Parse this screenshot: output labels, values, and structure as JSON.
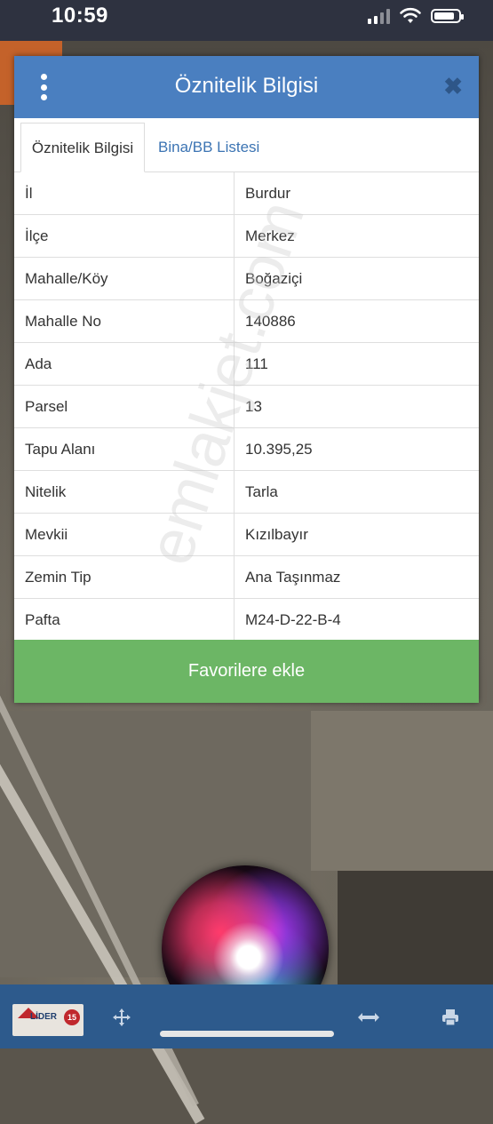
{
  "status_bar": {
    "time": "10:59"
  },
  "dialog": {
    "title": "Öznitelik Bilgisi",
    "close_symbol": "✖",
    "tabs": [
      {
        "label": "Öznitelik Bilgisi",
        "active": true
      },
      {
        "label": "Bina/BB Listesi",
        "active": false
      }
    ],
    "rows": [
      {
        "key": "İl",
        "value": "Burdur"
      },
      {
        "key": "İlçe",
        "value": "Merkez"
      },
      {
        "key": "Mahalle/Köy",
        "value": "Boğaziçi"
      },
      {
        "key": "Mahalle No",
        "value": "140886"
      },
      {
        "key": "Ada",
        "value": "111"
      },
      {
        "key": "Parsel",
        "value": "13"
      },
      {
        "key": "Tapu Alanı",
        "value": "10.395,25"
      },
      {
        "key": "Nitelik",
        "value": "Tarla"
      },
      {
        "key": "Mevkii",
        "value": "Kızılbayır"
      },
      {
        "key": "Zemin Tip",
        "value": "Ana Taşınmaz"
      },
      {
        "key": "Pafta",
        "value": "M24-D-22-B-4"
      }
    ],
    "favorite_button": "Favorilere ekle"
  },
  "watermark": "emlakjet.com",
  "toolbar": {
    "logo_text": "LİDER",
    "logo_number": "15",
    "icons": [
      "move-icon",
      "arrows-horizontal-icon",
      "printer-icon"
    ]
  },
  "colors": {
    "header": "#4a7fc0",
    "favorite_button": "#6cb665",
    "toolbar": "#2d5a8c",
    "tab_inactive_text": "#3c74b3"
  }
}
